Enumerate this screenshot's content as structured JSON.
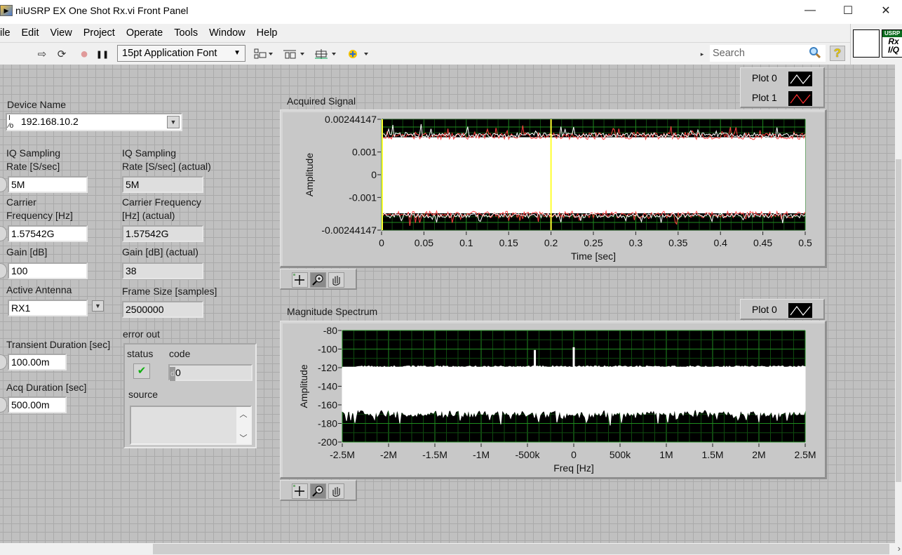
{
  "window": {
    "title": "niUSRP EX One Shot Rx.vi Front Panel",
    "app_icon": "labview-vi-icon",
    "controls": {
      "minimize": "—",
      "maximize": "☐",
      "close": "✕"
    }
  },
  "menu": [
    "ile",
    "Edit",
    "View",
    "Project",
    "Operate",
    "Tools",
    "Window",
    "Help"
  ],
  "toolbar": {
    "run_icon": "⇨",
    "run_continuously_icon": "⟳",
    "abort_icon": "●",
    "pause_icon": "❚❚",
    "font_select": "15pt Application Font",
    "align_icon": "align-objects",
    "distribute_icon": "distribute-objects",
    "resize_icon": "resize-objects",
    "reorder_icon": "reorder",
    "search_placeholder": "Search",
    "help_label": "?"
  },
  "connector": {
    "icon_banner": "USRP",
    "icon_text_1": "Rx",
    "icon_text_2": "I/Q"
  },
  "controls": {
    "device_name": {
      "label": "Device Name",
      "value": "192.168.10.2",
      "prefix": "I/O"
    },
    "iq_rate": {
      "label_1": "IQ Sampling",
      "label_2": "Rate [S/sec]",
      "value": "5M"
    },
    "iq_rate_actual": {
      "label_1": "IQ Sampling",
      "label_2": "Rate [S/sec] (actual)",
      "value": "5M"
    },
    "carrier_freq": {
      "label_1": "Carrier",
      "label_2": "Frequency [Hz]",
      "value": "1.57542G"
    },
    "carrier_freq_actual": {
      "label_1": "Carrier Frequency",
      "label_2": "[Hz] (actual)",
      "value": "1.57542G"
    },
    "gain": {
      "label": "Gain [dB]",
      "value": "100"
    },
    "gain_actual": {
      "label": "Gain [dB] (actual)",
      "value": "38"
    },
    "active_antenna": {
      "label": "Active Antenna",
      "value": "RX1"
    },
    "frame_size": {
      "label": "Frame Size [samples]",
      "value": "2500000"
    },
    "transient_duration": {
      "label": "Transient Duration [sec]",
      "value": "100.00m"
    },
    "acq_duration": {
      "label": "Acq Duration [sec]",
      "value": "500.00m"
    }
  },
  "error_out": {
    "label": "error out",
    "status_label": "status",
    "status_value": "✔",
    "code_label": "code",
    "code_prefix": "d",
    "code_value": "0",
    "source_label": "source",
    "source_value": ""
  },
  "chart_data": [
    {
      "type": "line",
      "title": "Acquired Signal",
      "xlabel": "Time [sec]",
      "ylabel": "Amplitude",
      "xlim": [
        0,
        0.5
      ],
      "ylim": [
        -0.00244147,
        0.00244147
      ],
      "x_ticks": [
        "0",
        "0.05",
        "0.1",
        "0.15",
        "0.2",
        "0.25",
        "0.3",
        "0.35",
        "0.4",
        "0.45",
        "0.5"
      ],
      "y_ticks": [
        "0.00244147",
        "0.001",
        "0",
        "-0.001",
        "-0.00244147"
      ],
      "y_tick_values": [
        0.00244147,
        0.001,
        0,
        -0.001,
        -0.00244147
      ],
      "grid": true,
      "legend": "top-right",
      "cursor_x": [
        0,
        0.2
      ],
      "series": [
        {
          "name": "Plot 0",
          "color": "#ffffff",
          "description": "noise envelope approx ±0.0019 with peaks to ±0.0023"
        },
        {
          "name": "Plot 1",
          "color": "#ff3030",
          "description": "noise envelope approx ±0.0019 with peaks to ±0.0023"
        }
      ],
      "envelope": {
        "upper_mean": 0.00185,
        "upper_peak": 0.0023,
        "lower_mean": -0.0019,
        "lower_peak": -0.0024
      }
    },
    {
      "type": "line",
      "title": "Magnitude Spectrum",
      "xlabel": "Freq [Hz]",
      "ylabel": "Amplitude",
      "xlim": [
        -2500000,
        2500000
      ],
      "ylim": [
        -200,
        -80
      ],
      "x_ticks": [
        "-2.5M",
        "-2M",
        "-1.5M",
        "-1M",
        "-500k",
        "0",
        "500k",
        "1M",
        "1.5M",
        "2M",
        "2.5M"
      ],
      "y_ticks": [
        "-80",
        "-100",
        "-120",
        "-140",
        "-160",
        "-180",
        "-200"
      ],
      "y_tick_values": [
        -80,
        -100,
        -120,
        -140,
        -160,
        -180,
        -200
      ],
      "grid": true,
      "legend": "top-right",
      "series": [
        {
          "name": "Plot 0",
          "color": "#ffffff"
        }
      ],
      "envelope": {
        "upper_mean": -117,
        "lower_mean": -168,
        "lower_dips_to": -184
      },
      "spurs": [
        {
          "freq": -420000,
          "level": -101
        },
        {
          "freq": 0,
          "level": -98
        }
      ]
    }
  ]
}
